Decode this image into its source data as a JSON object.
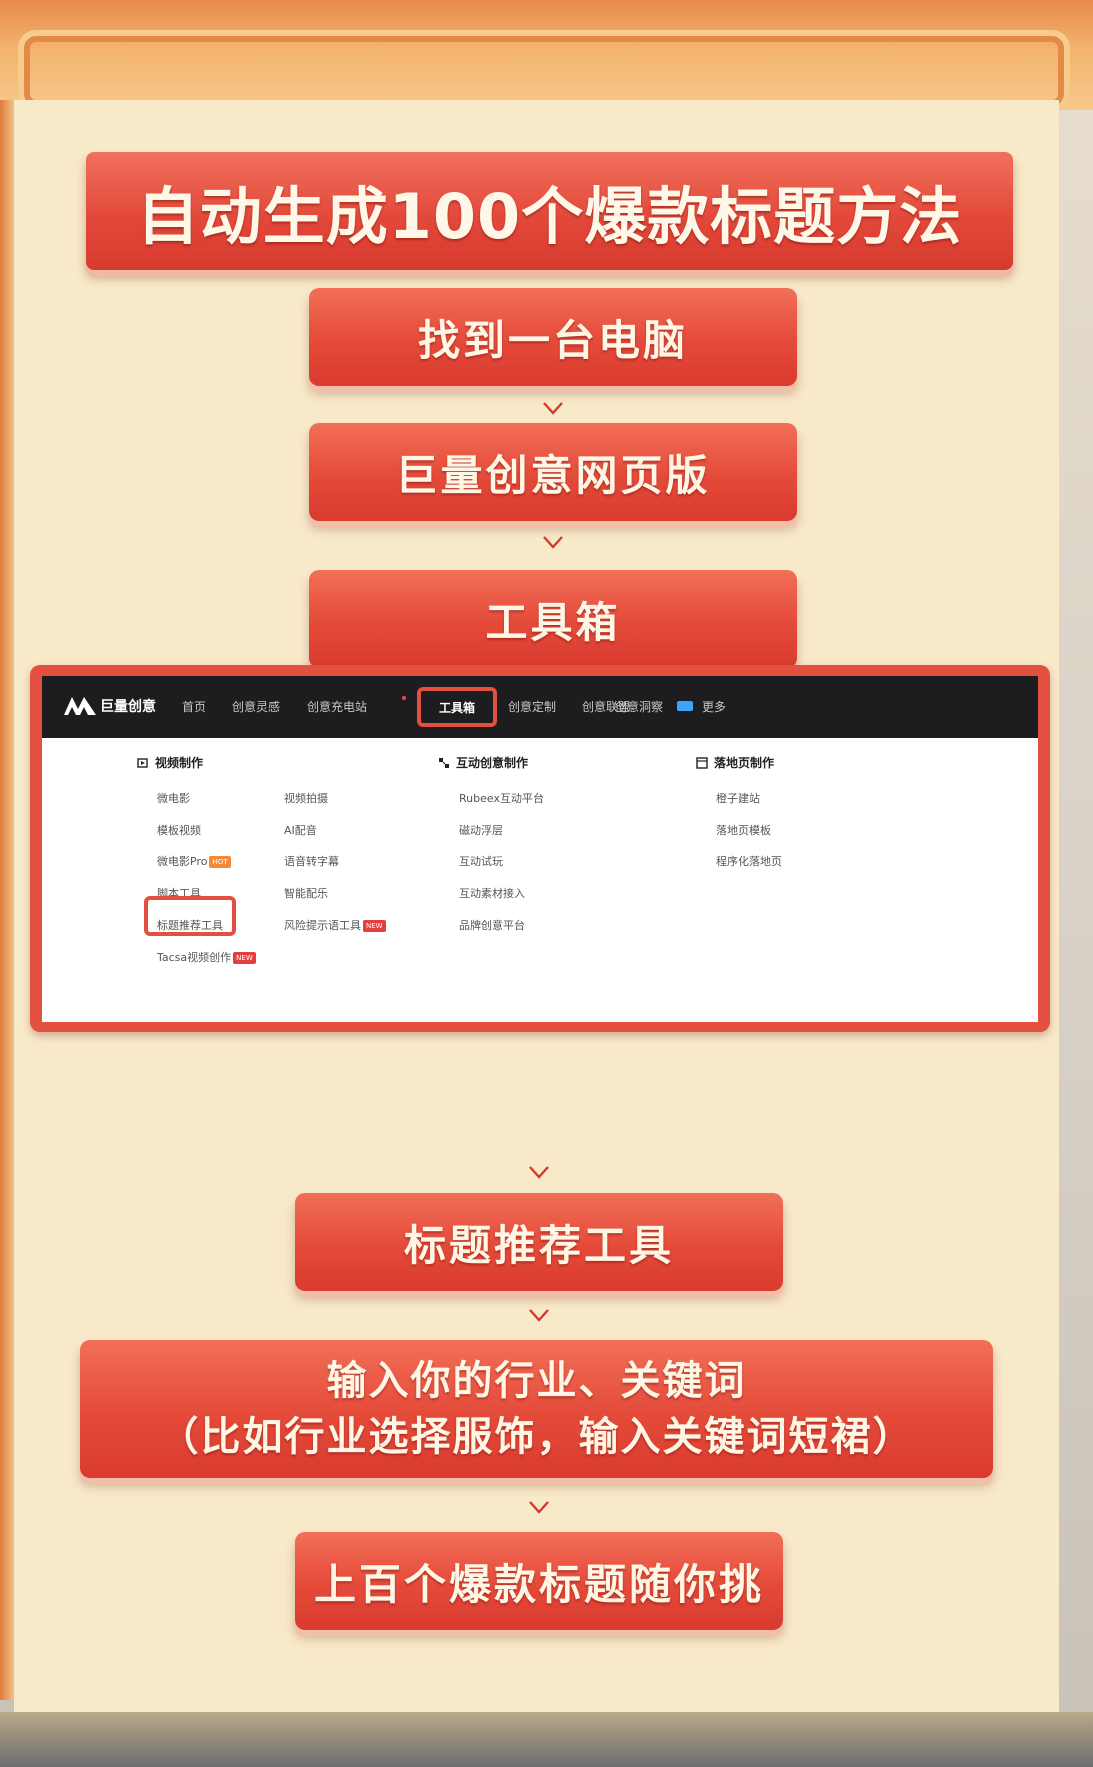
{
  "title": "自动生成100个爆款标题方法",
  "steps": [
    "找到一台电脑",
    "巨量创意网页版",
    "工具箱",
    "标题推荐工具"
  ],
  "step_wide": {
    "line1": "输入你的行业、关键词",
    "line2": "（比如行业选择服饰，输入关键词短裙）"
  },
  "final_step": "上百个爆款标题随你挑",
  "screenshot": {
    "logo": "巨量创意",
    "nav": [
      "首页",
      "创意灵感",
      "创意充电站",
      "工具箱",
      "创意定制",
      "创意联盟",
      "创意洞察",
      "更多"
    ],
    "active_nav": "工具箱",
    "columns": {
      "video": {
        "heading": "视频制作",
        "col1": [
          "微电影",
          "模板视频",
          "微电影Pro",
          "脚本工具",
          "标题推荐工具",
          "Tacsa视频创作"
        ],
        "col2": [
          "视频拍摄",
          "AI配音",
          "语音转字幕",
          "智能配乐",
          "风险提示语工具"
        ]
      },
      "interactive": {
        "heading": "互动创意制作",
        "items": [
          "Rubeex互动平台",
          "磁动浮层",
          "互动试玩",
          "互动素材接入",
          "品牌创意平台"
        ]
      },
      "landing": {
        "heading": "落地页制作",
        "items": [
          "橙子建站",
          "落地页模板",
          "程序化落地页"
        ]
      }
    },
    "tags": {
      "hot": "HOT",
      "new": "NEW"
    }
  },
  "colors": {
    "banner_red": "#e3493a",
    "panel_cream": "#f8e9c9",
    "nav_dark": "#1d1d1f"
  }
}
